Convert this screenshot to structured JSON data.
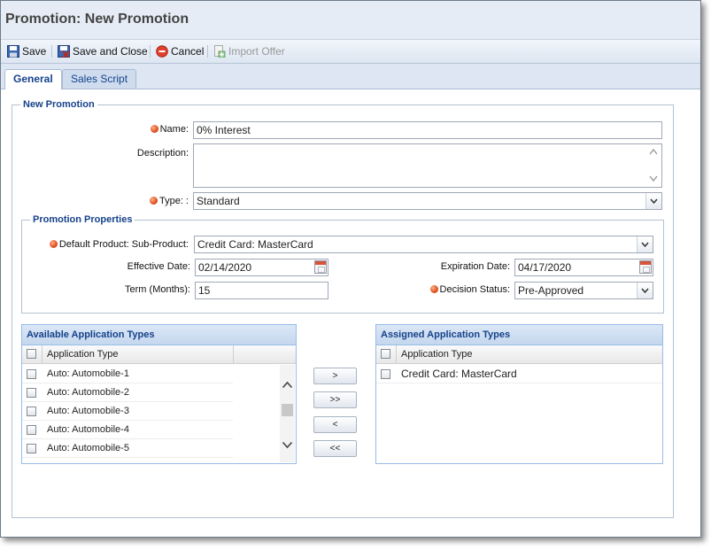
{
  "window": {
    "title": "Promotion: New Promotion"
  },
  "toolbar": {
    "save": "Save",
    "save_close": "Save and Close",
    "cancel": "Cancel",
    "import_offer": "Import Offer"
  },
  "tabs": [
    {
      "label": "General",
      "active": true
    },
    {
      "label": "Sales Script",
      "active": false
    }
  ],
  "form": {
    "section_title": "New Promotion",
    "name_label": "Name:",
    "name_value": "0% Interest",
    "description_label": "Description:",
    "description_value": "",
    "type_label": "Type: :",
    "type_value": "Standard"
  },
  "properties": {
    "title": "Promotion Properties",
    "default_product_label": "Default Product: Sub-Product:",
    "default_product_value": "Credit Card: MasterCard",
    "effective_date_label": "Effective Date:",
    "effective_date_value": "02/14/2020",
    "expiration_date_label": "Expiration Date:",
    "expiration_date_value": "04/17/2020",
    "term_label": "Term (Months):",
    "term_value": "15",
    "decision_status_label": "Decision Status:",
    "decision_status_value": "Pre-Approved"
  },
  "available": {
    "title": "Available Application Types",
    "column": "Application Type",
    "rows": [
      "Auto: Automobile-1",
      "Auto: Automobile-2",
      "Auto: Automobile-3",
      "Auto: Automobile-4",
      "Auto: Automobile-5"
    ]
  },
  "assigned": {
    "title": "Assigned Application Types",
    "column": "Application Type",
    "rows": [
      "Credit Card: MasterCard"
    ]
  },
  "move_buttons": {
    "add": ">",
    "add_all": ">>",
    "remove": "<",
    "remove_all": "<<"
  },
  "colors": {
    "accent": "#15428b",
    "required": "#e0501f",
    "header_bg": "#e6ecf5"
  }
}
